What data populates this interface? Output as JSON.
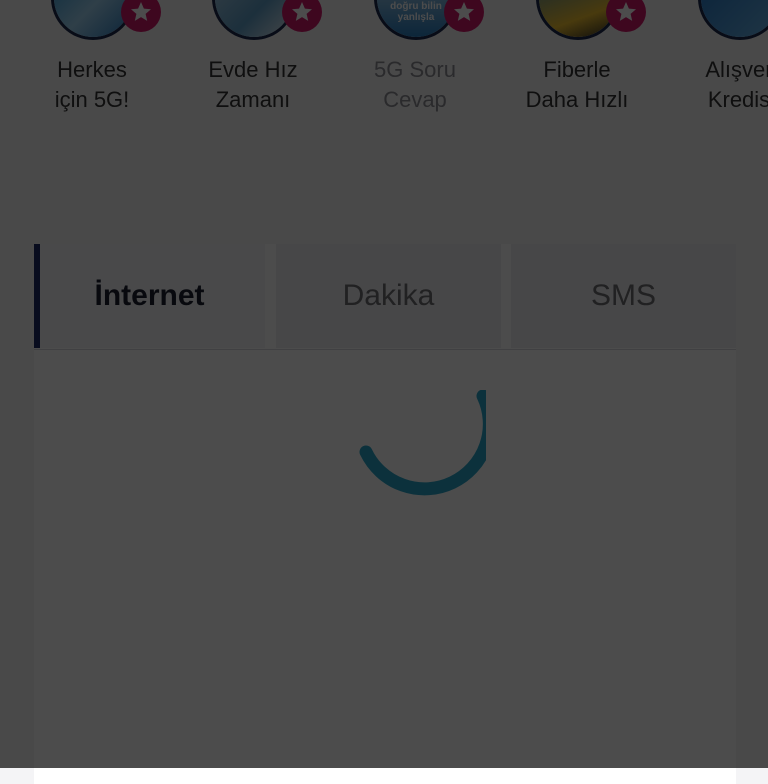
{
  "stories": [
    {
      "line1": "Herkes",
      "line2": "için 5G!",
      "thumb_color": "#1f8fd0",
      "thumb_text": "",
      "muted": false
    },
    {
      "line1": "Evde Hız",
      "line2": "Zamanı",
      "thumb_color": "#5f9fc8",
      "thumb_text": "",
      "muted": false
    },
    {
      "line1": "5G Soru",
      "line2": "Cevap",
      "thumb_color": "#2a7fc2",
      "thumb_text": "doğru bilin\nyanlışla",
      "muted": true
    },
    {
      "line1": "Fiberle",
      "line2": "Daha Hızlı",
      "thumb_color": "#2178bf",
      "thumb_text": "",
      "muted": false
    },
    {
      "line1": "Alışver",
      "line2": "Kredis",
      "thumb_color": "#1d6fc0",
      "thumb_text": "",
      "muted": false
    }
  ],
  "tabs": {
    "internet": "İnternet",
    "dakika": "Dakika",
    "sms": "SMS",
    "active": "internet"
  },
  "colors": {
    "badge": "#d1186a",
    "tab_indicator": "#1c2b66",
    "spinner": "#2aa6c8",
    "overlay": "rgba(0,0,0,0.7)"
  },
  "icons": {
    "badge": "star-icon",
    "loading": "loading-spinner"
  }
}
